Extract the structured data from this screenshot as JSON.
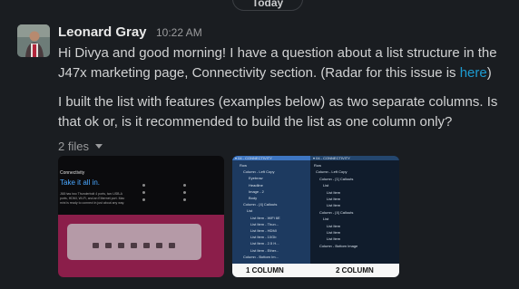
{
  "day_divider": "Today",
  "message": {
    "author": "Leonard Gray",
    "time": "10:22 AM",
    "paragraph1_text": "Hi Divya and good morning! I have a question about a list structure in the J47x marketing page, Connectivity section. (Radar for this issue is ",
    "paragraph1_link": "here",
    "paragraph1_end": ")",
    "paragraph2": "I built the list with features (examples below) as two separate columns. Is that ok or, is it recommended to build the list as one column only?",
    "files_toggle": "2 files"
  },
  "attachments": [
    {
      "kind": "marketing-preview",
      "eyebrow": "Connectivity",
      "headline": "Take it all in.",
      "body": "J68 has two Thunderbolt 4 ports, two USB-A ports, HDMI, Wi-Fi, and an Ethernet port. Mac mini is ready to connect in just about any way."
    },
    {
      "kind": "list-structure",
      "left_header": "▾ 04 - CONNECTIVITY",
      "right_header": "▾ 04 - CONNECTIVITY",
      "left_rows": [
        "Row",
        "Column - Left Copy",
        "Eyebrow",
        "Headline",
        "Image - 2",
        "Body",
        "Column - [4] Callouts",
        "List",
        "List Item - WiFi 6E",
        "List Item - Thun...",
        "List Item - HDMI",
        "List Item - 10Gb",
        "List Item - 2.5 H...",
        "List Item - Ether...",
        "Column - Bottom Im..."
      ],
      "right_rows": [
        "Row",
        "Column - Left Copy",
        "Column - [1] Callouts",
        "List",
        "List Item",
        "List Item",
        "List Item",
        "Column - [4] Callouts",
        "List",
        "List Item",
        "List Item",
        "List Item",
        "Column - Bottom Image"
      ],
      "label_left": "1 COLUMN",
      "label_right": "2 COLUMN"
    }
  ]
}
